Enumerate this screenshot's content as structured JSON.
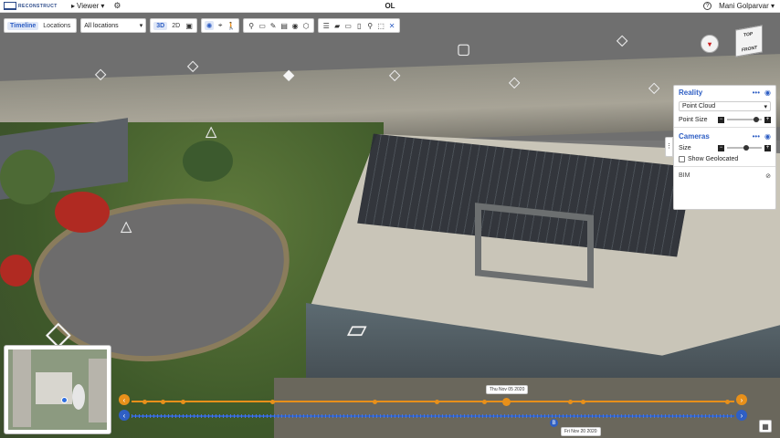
{
  "app": {
    "logo_text": "RECONSTRUCT",
    "title": "OL"
  },
  "topbar": {
    "viewer_label": "Viewer",
    "help_label": "?",
    "user_name": "Mani Golparvar"
  },
  "toolbar": {
    "view_tabs": [
      "Timeline",
      "Locations"
    ],
    "location_select": "All locations",
    "mode_3d": "3D",
    "mode_2d": "2D"
  },
  "navcube": {
    "top": "TOP",
    "front": "FRONT"
  },
  "panel": {
    "reality_title": "Reality",
    "reality_select": "Point Cloud",
    "point_size_label": "Point Size",
    "point_size_level": 0.85,
    "cameras_title": "Cameras",
    "size_label": "Size",
    "size_level": 0.55,
    "show_geolocated_label": "Show Geolocated",
    "bim_label": "BIM",
    "more_label": "•••"
  },
  "timeline": {
    "upper_date": "Thu Nov 05 2020",
    "lower_date": "Fri Nov 20 2020",
    "marker_b": "B"
  },
  "colors": {
    "accent": "#2f5fc4",
    "timeline_orange": "#e8901a"
  }
}
